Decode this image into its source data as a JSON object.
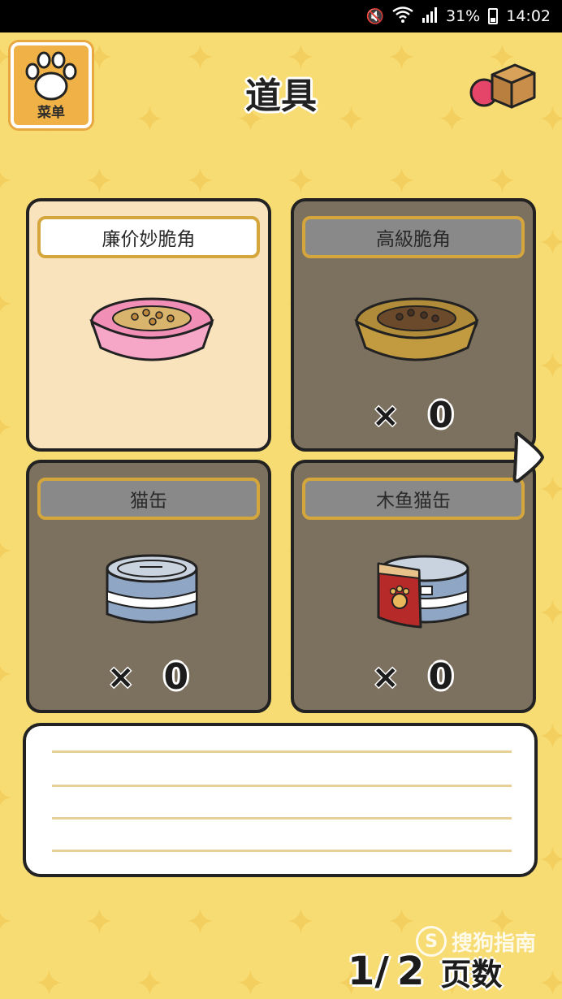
{
  "status_bar": {
    "battery": "31%",
    "time": "14:02"
  },
  "header": {
    "menu_label": "菜单",
    "title": "道具"
  },
  "items": [
    {
      "name": "廉价妙脆角",
      "selected": true,
      "count_shown": false
    },
    {
      "name": "高級脆角",
      "x": "×",
      "count": "0",
      "selected": false
    },
    {
      "name": "猫缶",
      "x": "×",
      "count": "0",
      "selected": false
    },
    {
      "name": "木鱼猫缶",
      "x": "×",
      "count": "0",
      "selected": false
    }
  ],
  "description": {
    "text": ""
  },
  "pagination": {
    "current": "1/",
    "total": "2",
    "label": "页数"
  },
  "watermark": {
    "icon": "S",
    "text": "搜狗指南"
  }
}
